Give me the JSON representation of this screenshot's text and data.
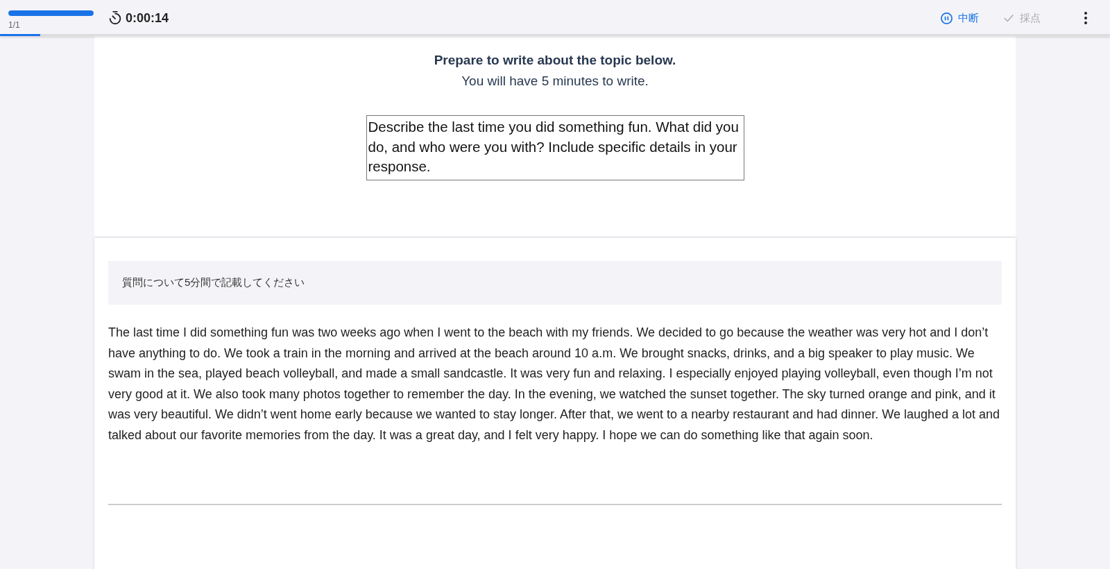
{
  "header": {
    "question_progress": {
      "level": 1.0,
      "label": "1/1"
    },
    "timer": "0:00:14",
    "pause_button": {
      "label": "中断"
    },
    "grade_button": {
      "label": "採点",
      "disabled": true
    },
    "page_progress": {
      "level": 0.036
    }
  },
  "instructions": {
    "title": "Prepare to write about the topic below.",
    "subtitle": "You will have 5 minutes to write.",
    "topic": "Describe the last time you did something fun. What did you do, and who were you with? Include specific details in your response."
  },
  "answer": {
    "hint": "質問について5分間で記載してください",
    "text": "The last time I did something fun was two weeks ago when I went to the beach with my friends. We decided to go because the weather was very hot and I don’t have anything to do. We took a train in the morning and arrived at the beach around 10 a.m. We brought snacks, drinks, and a big speaker to play music. We swam in the sea, played beach volleyball, and made a small sandcastle. It was very fun and relaxing. I especially enjoyed playing volleyball, even though I’m not very good at it. We also took many photos together to remember the day. In the evening, we watched the sunset together. The sky turned orange and pink, and it was very beautiful. We didn’t went home early because we wanted to stay longer. After that, we went to a nearby restaurant and had dinner. We laughed a lot and talked about our favorite memories from the day. It was a great day, and I felt very happy. I hope we can do something like that again soon."
  }
}
